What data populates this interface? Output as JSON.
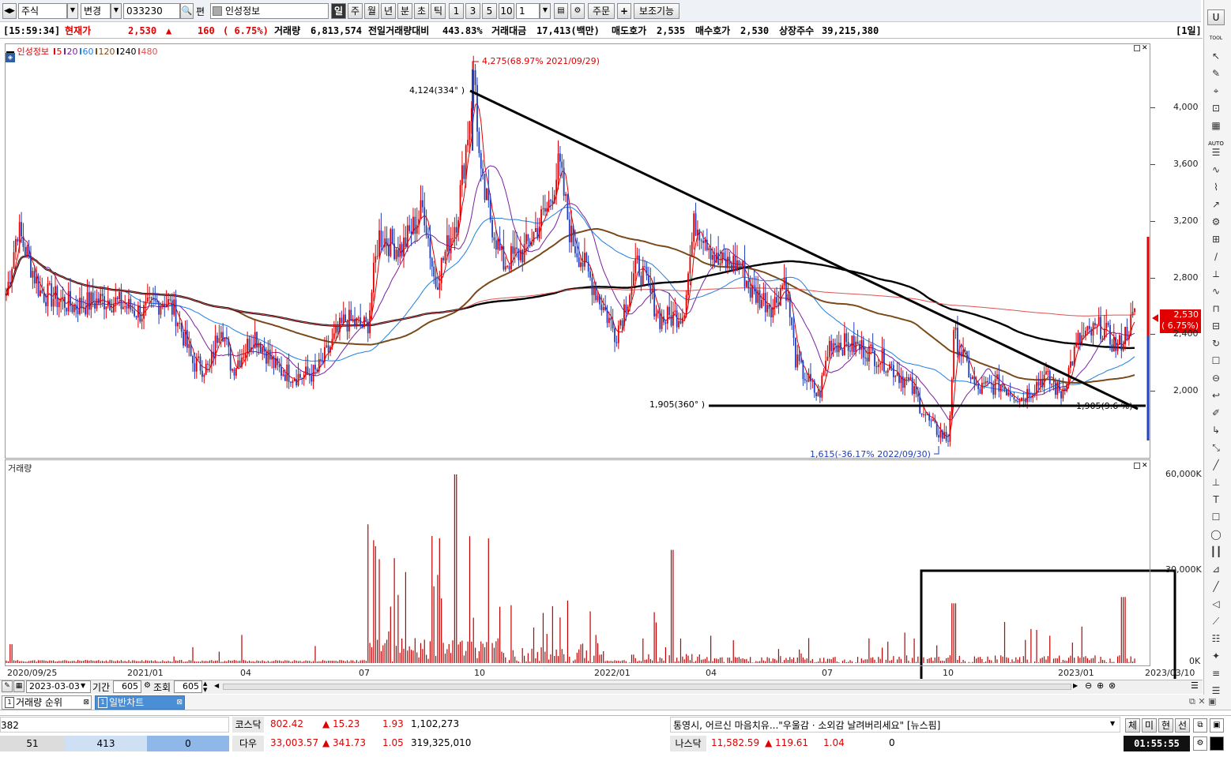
{
  "toolbar": {
    "market": "주식",
    "change_btn": "변경",
    "code": "033230",
    "pyeon": "편",
    "stock_name": "인성정보",
    "periods": [
      "일",
      "주",
      "월",
      "년",
      "분",
      "초",
      "틱"
    ],
    "nums": [
      "1",
      "3",
      "5",
      "10"
    ],
    "period_value": "1",
    "order_btn": "주문",
    "assist_btn": "보조기능"
  },
  "quote": {
    "time": "[15:59:34]",
    "price_label": "현재가",
    "price": "2,530",
    "arrow": "▲",
    "change": "160",
    "change_pct": "( 6.75%)",
    "volume_label": "거래량",
    "volume": "6,813,574",
    "prev_label": "전일거래량대비",
    "prev_ratio": "443.83%",
    "amount_label": "거래대금",
    "amount": "17,413(백만)",
    "ask_label": "매도호가",
    "ask": "2,535",
    "bid_label": "매수호가",
    "bid": "2,530",
    "listed_label": "상장주수",
    "listed": "39,215,380",
    "period_tag": "[1일]"
  },
  "price_legend": {
    "name": "인성정보",
    "ma": [
      "5",
      "20",
      "60",
      "120",
      "240",
      "480"
    ],
    "ma_colors": [
      "#e00000",
      "#7a1fa0",
      "#1f7fe0",
      "#7a4a1a",
      "#000000",
      "#e05050"
    ]
  },
  "volume_legend": "거래량",
  "annotations": {
    "high": "4,275(68.97% 2021/09/29)",
    "line_start": "4,124(334° )",
    "support_label": "1,905(360° )",
    "low": "1,615(-36.17% 2022/09/30)",
    "support_right": "1,905(9.6 %)"
  },
  "price_badge": {
    "price": "2,530",
    "pct": "( 6.75%)"
  },
  "price_axis": [
    "4,000",
    "3,600",
    "3,200",
    "2,800",
    "2,400",
    "2,000"
  ],
  "volume_axis": [
    "60,000K",
    "30,000K",
    "0K"
  ],
  "x_axis": [
    "2020/09/25",
    "2021/01",
    "04",
    "07",
    "10",
    "2022/01",
    "04",
    "07",
    "10",
    "2023/01",
    "2023/03/10"
  ],
  "bottom_controls": {
    "date": "2023-03-03",
    "period_label": "기간",
    "period": "605",
    "query_label": "조회",
    "query": "605"
  },
  "tabs": [
    {
      "num": "1",
      "label": "거래량 순위"
    },
    {
      "num": "1",
      "label": "일반차트"
    }
  ],
  "status": {
    "left_top": "382",
    "left_vals": [
      "51",
      "413",
      "0"
    ],
    "rows": [
      {
        "name": "코스닥",
        "value": "802.42",
        "chg": "▲ 15.23",
        "pct": "1.93",
        "vol": "1,102,273"
      },
      {
        "name": "다우",
        "value": "33,003.57",
        "chg": "▲ 341.73",
        "pct": "1.05",
        "vol": "319,325,010"
      }
    ],
    "news": "통영시, 어르신 마음치유...\"우울감 · 소외감 날려버리세요\" [뉴스핌]",
    "nasdaq": {
      "name": "나스닥",
      "value": "11,582.59",
      "chg": "▲ 119.61",
      "pct": "1.04",
      "vol": "0"
    },
    "right_btns": [
      "체",
      "미",
      "현",
      "선"
    ],
    "clock": "01:55:55"
  },
  "right_toolbar": {
    "top": "U",
    "tool_label": "TOOL",
    "auto_label": "AUTO"
  },
  "chart_data": {
    "type": "line",
    "title": "인성정보",
    "x": [
      "2020/09/25",
      "2021/01",
      "2021/04",
      "2021/07",
      "2021/10",
      "2022/01",
      "2022/04",
      "2022/07",
      "2022/10",
      "2023/01",
      "2023/03/10"
    ],
    "series": [
      {
        "name": "인성정보",
        "values": [
          2700,
          2500,
          2300,
          2500,
          3500,
          3000,
          2700,
          2350,
          1900,
          2150,
          2530
        ]
      }
    ],
    "xlabel": "",
    "ylabel": "",
    "ylim": [
      1600,
      4300
    ],
    "volume_ylim_k": [
      0,
      60000
    ]
  }
}
